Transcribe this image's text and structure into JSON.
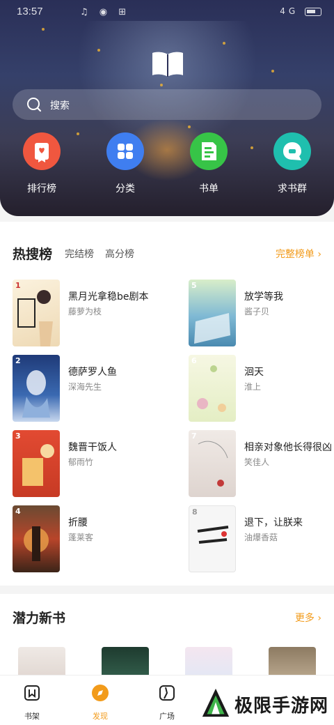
{
  "status_bar": {
    "time": "13:57",
    "signal": "4G",
    "left_icons": "♫ ◉ ⊞",
    "right_icons": "✱ ⧖ 4G 📶"
  },
  "search": {
    "placeholder": "搜索"
  },
  "quick_actions": [
    {
      "label": "排行榜",
      "icon": "ranking-ribbon-icon",
      "color": "#f0573f"
    },
    {
      "label": "分类",
      "icon": "category-grid-icon",
      "color": "#3f7ef0"
    },
    {
      "label": "书单",
      "icon": "booklist-icon",
      "color": "#37c447"
    },
    {
      "label": "求书群",
      "icon": "chat-bubble-icon",
      "color": "#1fbfae"
    }
  ],
  "hot": {
    "title": "热搜榜",
    "tabs": [
      "完结榜",
      "高分榜"
    ],
    "more": "完整榜单 ›",
    "items": [
      {
        "rank": "1",
        "title": "黑月光拿稳be剧本",
        "author": "藤萝为枝",
        "cover_color": "#f4e4c8"
      },
      {
        "rank": "2",
        "title": "德萨罗人鱼",
        "author": "深海先生",
        "cover_color": "#2c4a86"
      },
      {
        "rank": "3",
        "title": "魏晋干饭人",
        "author": "郁雨竹",
        "cover_color": "#d8462e"
      },
      {
        "rank": "4",
        "title": "折腰",
        "author": "蓬莱客",
        "cover_color": "#a23a24"
      },
      {
        "rank": "5",
        "title": "放学等我",
        "author": "酱子贝",
        "cover_color": "#7fb5c9"
      },
      {
        "rank": "6",
        "title": "洄天",
        "author": "淮上",
        "cover_color": "#eef1d8"
      },
      {
        "rank": "7",
        "title": "相亲对象他长得很凶",
        "author": "笑佳人",
        "cover_color": "#ece6e0"
      },
      {
        "rank": "8",
        "title": "退下，让朕来",
        "author": "油爆香菇",
        "cover_color": "#f4f4f4"
      }
    ]
  },
  "new_books": {
    "title": "潜力新书",
    "more": "更多 ›"
  },
  "tabbar": [
    {
      "label": "书架",
      "icon": "bookshelf-icon"
    },
    {
      "label": "发现",
      "icon": "discover-compass-icon"
    },
    {
      "label": "广场",
      "icon": "square-plaza-icon"
    }
  ],
  "watermark": {
    "text": "极限手游网"
  },
  "colors": {
    "accent": "#f29b1b",
    "hero_bg": "#2a2f57"
  }
}
